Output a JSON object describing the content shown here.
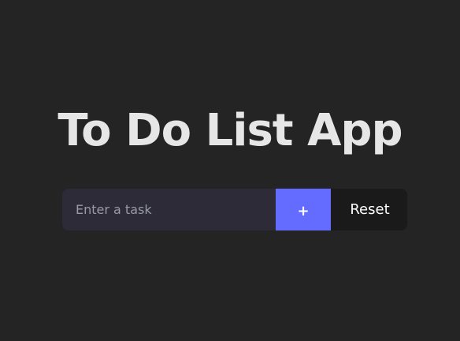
{
  "app": {
    "title": "To Do List App"
  },
  "task_form": {
    "input_value": "",
    "input_placeholder": "Enter a task",
    "add_label": "+",
    "reset_label": "Reset"
  },
  "colors": {
    "background": "#242424",
    "title_text": "#e6e6e6",
    "input_background": "#2c2b37",
    "add_button": "#646cff",
    "reset_button": "#1a1a1a"
  }
}
